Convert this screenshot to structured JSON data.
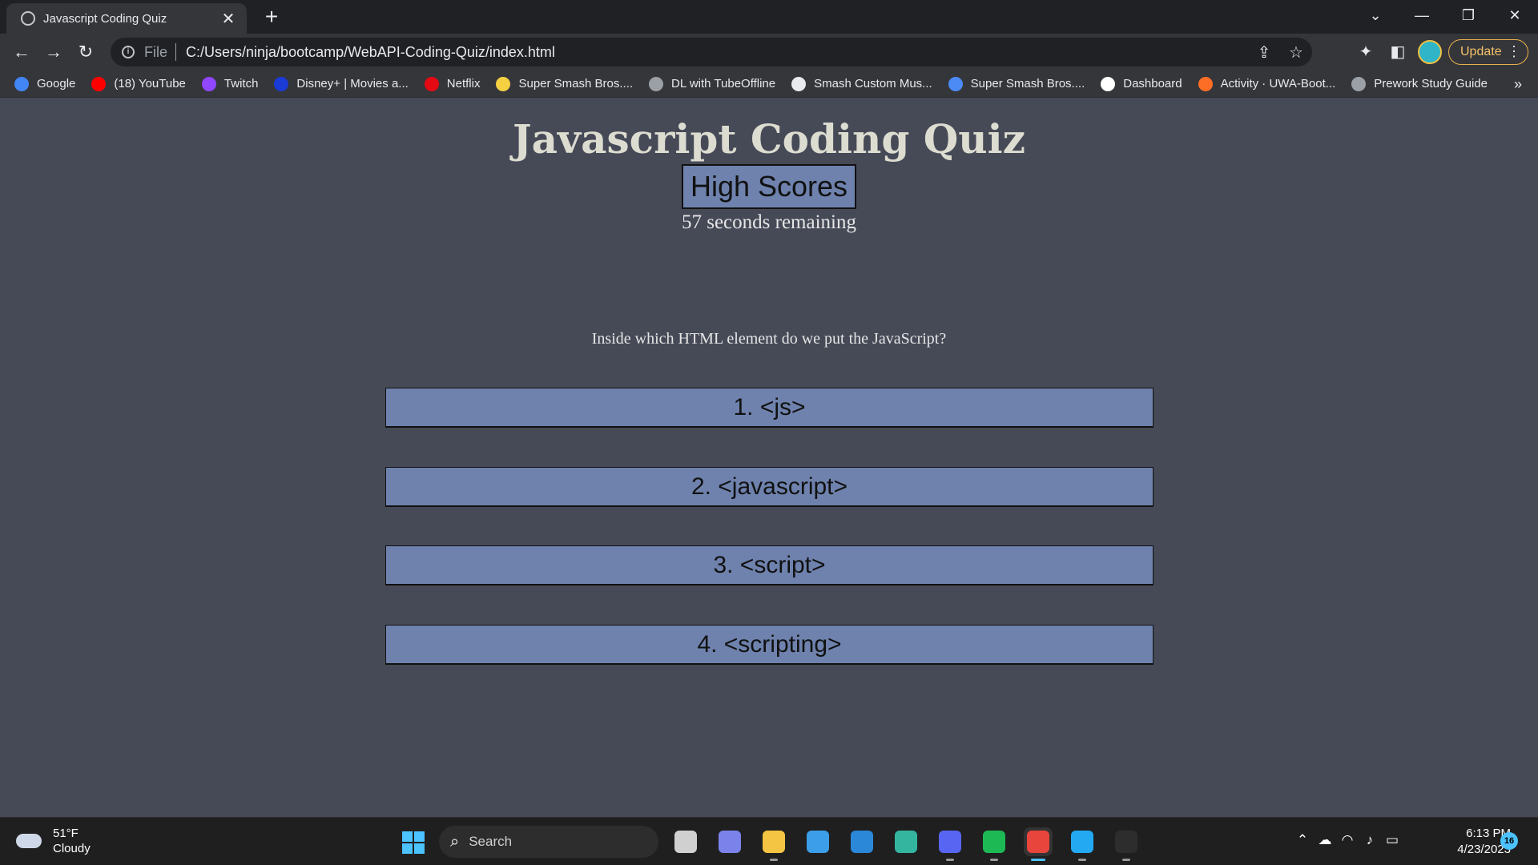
{
  "browser": {
    "tab_title": "Javascript Coding Quiz",
    "tab_close": "✕",
    "new_tab": "+",
    "scheme_label": "File",
    "url": "C:/Users/ninja/bootcamp/WebAPI-Coding-Quiz/index.html",
    "update_label": "Update",
    "window_controls": [
      "⌄",
      "—",
      "❐",
      "✕"
    ]
  },
  "bookmarks": [
    {
      "label": "Google",
      "icon": "google-icon",
      "color": "#4285f4"
    },
    {
      "label": "(18) YouTube",
      "icon": "youtube-icon",
      "color": "#ff0000"
    },
    {
      "label": "Twitch",
      "icon": "twitch-icon",
      "color": "#9146ff"
    },
    {
      "label": "Disney+ | Movies a...",
      "icon": "disney-icon",
      "color": "#1a3bd6"
    },
    {
      "label": "Netflix",
      "icon": "netflix-icon",
      "color": "#e50914"
    },
    {
      "label": "Super Smash Bros....",
      "icon": "banana-icon",
      "color": "#f5d142"
    },
    {
      "label": "DL with TubeOffline",
      "icon": "globe-icon",
      "color": "#9aa0a6"
    },
    {
      "label": "Smash Custom Mus...",
      "icon": "music-note-icon",
      "color": "#e8eaed"
    },
    {
      "label": "Super Smash Bros....",
      "icon": "doc-icon",
      "color": "#4c8bf5"
    },
    {
      "label": "Dashboard",
      "icon": "w-icon",
      "color": "#ffffff"
    },
    {
      "label": "Activity · UWA-Boot...",
      "icon": "gitlab-icon",
      "color": "#fc6d26"
    },
    {
      "label": "Prework Study Guide",
      "icon": "globe-icon",
      "color": "#9aa0a6"
    }
  ],
  "bookmarks_more": "»",
  "quiz": {
    "title": "Javascript Coding Quiz",
    "high_scores_label": "High Scores",
    "timer_text": "57 seconds remaining",
    "question": "Inside which HTML element do we put the JavaScript?",
    "answers": [
      "1. <js>",
      "2. <javascript>",
      "3. <script>",
      "4. <scripting>"
    ],
    "colors": {
      "background": "#464a57",
      "button": "#6e82ad",
      "title": "#dcdcd0"
    }
  },
  "taskbar": {
    "weather_temp": "51°F",
    "weather_desc": "Cloudy",
    "search_label": "Search",
    "time": "6:13 PM",
    "date": "4/23/2023",
    "notification_count": "16",
    "apps": [
      {
        "name": "task-view-icon",
        "color": "#d0d0d0",
        "running": false,
        "active": false
      },
      {
        "name": "chat-icon",
        "color": "#7b83eb",
        "running": false,
        "active": false
      },
      {
        "name": "file-explorer-icon",
        "color": "#f4c542",
        "running": true,
        "active": false
      },
      {
        "name": "microsoft-store-icon",
        "color": "#3c9ee8",
        "running": false,
        "active": false
      },
      {
        "name": "mail-icon",
        "color": "#2b88d8",
        "running": false,
        "active": false
      },
      {
        "name": "edge-icon",
        "color": "#33b5a0",
        "running": false,
        "active": false
      },
      {
        "name": "discord-icon",
        "color": "#5865f2",
        "running": true,
        "active": false
      },
      {
        "name": "spotify-icon",
        "color": "#1db954",
        "running": true,
        "active": false
      },
      {
        "name": "chrome-icon",
        "color": "#e8453c",
        "running": true,
        "active": true
      },
      {
        "name": "vscode-icon",
        "color": "#23a9f2",
        "running": true,
        "active": false
      },
      {
        "name": "terminal-icon",
        "color": "#2d2d2d",
        "running": true,
        "active": false
      }
    ]
  }
}
